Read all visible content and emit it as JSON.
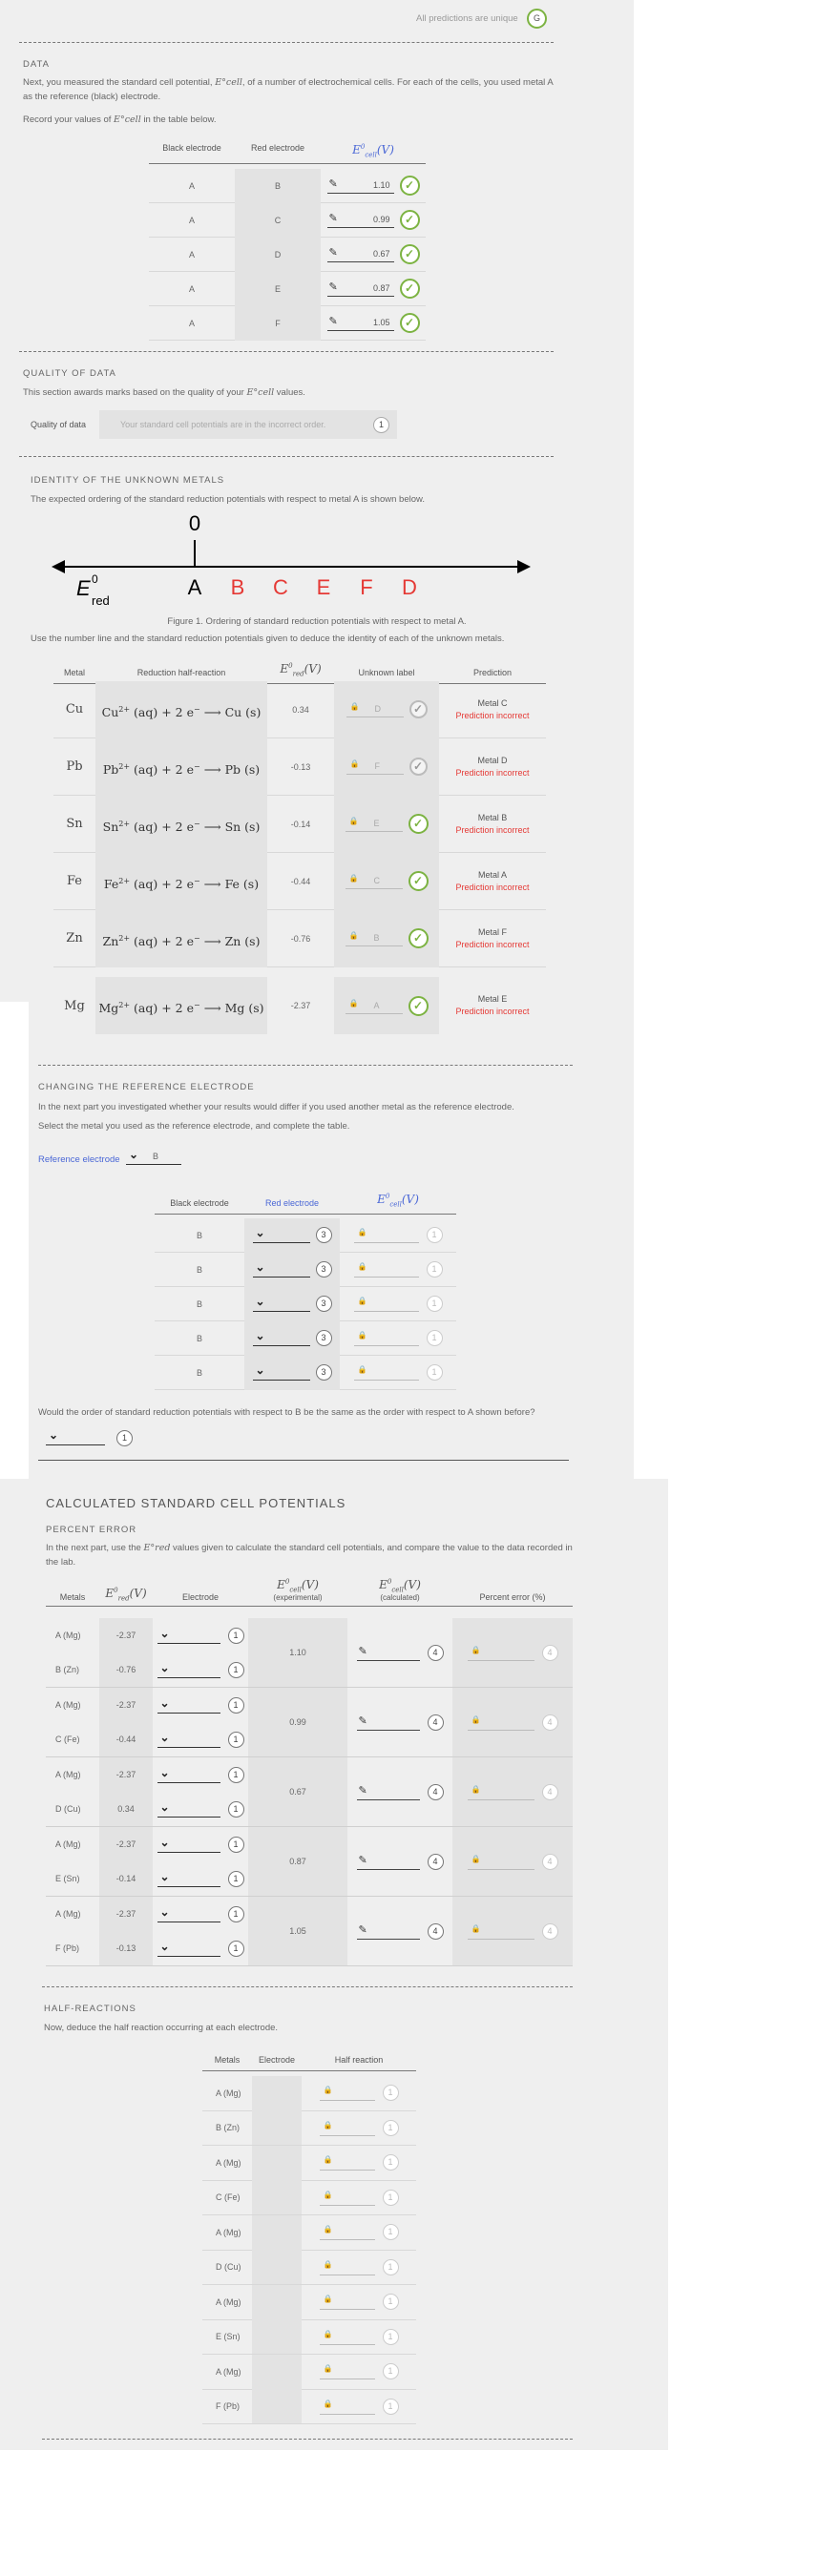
{
  "unique_note": "All predictions are unique",
  "unique_badge": "G",
  "data_section": {
    "heading": "DATA",
    "intro_a": "Next, you measured the standard cell potential, ",
    "intro_sym": "E°cell",
    "intro_b": ", of a number of electrochemical cells. For each of the cells, you used metal A as the reference (black) electrode.",
    "record_a": "Record your values of ",
    "record_b": " in the table below.",
    "col_black": "Black electrode",
    "col_red": "Red electrode",
    "col_e": "E°cell(V)",
    "rows": [
      {
        "black": "A",
        "red": "B",
        "value": "1.10"
      },
      {
        "black": "A",
        "red": "C",
        "value": "0.99"
      },
      {
        "black": "A",
        "red": "D",
        "value": "0.67"
      },
      {
        "black": "A",
        "red": "E",
        "value": "0.87"
      },
      {
        "black": "A",
        "red": "F",
        "value": "1.05"
      }
    ]
  },
  "quality": {
    "heading": "QUALITY OF DATA",
    "text_a": "This section awards marks based on the quality of your ",
    "text_b": " values.",
    "label": "Quality of data",
    "message": "Your standard cell potentials are in the incorrect order.",
    "badge": "1"
  },
  "identity": {
    "heading": "IDENTITY OF THE UNKNOWN METALS",
    "intro": "The expected ordering of the standard reduction potentials with respect to metal A is shown below.",
    "zero": "0",
    "ered": "E",
    "ered_sup": "0",
    "ered_sub": "red",
    "letters": [
      {
        "t": "A",
        "c": "#000"
      },
      {
        "t": "B",
        "c": "#e53935"
      },
      {
        "t": "C",
        "c": "#e53935"
      },
      {
        "t": "E",
        "c": "#e53935"
      },
      {
        "t": "F",
        "c": "#e53935"
      },
      {
        "t": "D",
        "c": "#e53935"
      }
    ],
    "caption": "Figure 1. Ordering of standard reduction potentials with respect to metal A.",
    "instr": "Use the number line and the standard reduction potentials given to deduce the identity of each of the unknown metals.",
    "col_metal": "Metal",
    "col_half": "Reduction half-reaction",
    "col_e": "E°red(V)",
    "col_label": "Unknown label",
    "col_pred": "Prediction",
    "rows": [
      {
        "metal": "Cu",
        "ion": "Cu",
        "charge": "2+",
        "e": "0.34",
        "label": "D",
        "ok": "grey",
        "pred": "Metal C",
        "status": "Prediction incorrect"
      },
      {
        "metal": "Pb",
        "ion": "Pb",
        "charge": "2+",
        "e": "-0.13",
        "label": "F",
        "ok": "grey",
        "pred": "Metal D",
        "status": "Prediction incorrect"
      },
      {
        "metal": "Sn",
        "ion": "Sn",
        "charge": "2+",
        "e": "-0.14",
        "label": "E",
        "ok": "green",
        "pred": "Metal B",
        "status": "Prediction incorrect"
      },
      {
        "metal": "Fe",
        "ion": "Fe",
        "charge": "2+",
        "e": "-0.44",
        "label": "C",
        "ok": "green",
        "pred": "Metal A",
        "status": "Prediction incorrect"
      },
      {
        "metal": "Zn",
        "ion": "Zn",
        "charge": "2+",
        "e": "-0.76",
        "label": "B",
        "ok": "green",
        "pred": "Metal F",
        "status": "Prediction incorrect"
      },
      {
        "metal": "Mg",
        "ion": "Mg",
        "charge": "2+",
        "e": "-2.37",
        "label": "A",
        "ok": "green",
        "pred": "Metal E",
        "status": "Prediction incorrect"
      }
    ]
  },
  "reference": {
    "heading": "CHANGING THE REFERENCE ELECTRODE",
    "p1": "In the next part you investigated whether your results would differ if you used another metal as the reference electrode.",
    "p2": "Select the metal you used as the reference electrode, and complete the table.",
    "label": "Reference electrode",
    "value": "B",
    "col_black": "Black electrode",
    "col_red": "Red electrode",
    "col_e": "E°cell(V)",
    "rows": [
      {
        "black": "B",
        "badge": "3",
        "lockbadge": "1"
      },
      {
        "black": "B",
        "badge": "3",
        "lockbadge": "1"
      },
      {
        "black": "B",
        "badge": "3",
        "lockbadge": "1"
      },
      {
        "black": "B",
        "badge": "3",
        "lockbadge": "1"
      },
      {
        "black": "B",
        "badge": "3",
        "lockbadge": "1"
      }
    ],
    "question": "Would the order of standard reduction potentials with respect to B be the same as the order with respect to A shown before?",
    "qbadge": "1"
  },
  "calc": {
    "title": "CALCULATED STANDARD CELL POTENTIALS",
    "sub": "PERCENT ERROR",
    "intro_a": "In the next part, use the ",
    "intro_b": " values given to calculate the standard cell potentials, and compare the value to the data recorded in the lab.",
    "col_metals": "Metals",
    "col_ered": "E°red(V)",
    "col_electrode": "Electrode",
    "col_exp": "E°cell(V)",
    "col_exp_sub": "(experimental)",
    "col_calc": "E°cell(V)",
    "col_calc_sub": "(calculated)",
    "col_pct": "Percent error (%)",
    "groups": [
      {
        "m1": "A (Mg)",
        "e1": "-2.37",
        "m2": "B (Zn)",
        "e2": "-0.76",
        "exp": "1.10",
        "b1": "1",
        "b2": "1",
        "cb": "4",
        "pb": "4"
      },
      {
        "m1": "A (Mg)",
        "e1": "-2.37",
        "m2": "C (Fe)",
        "e2": "-0.44",
        "exp": "0.99",
        "b1": "1",
        "b2": "1",
        "cb": "4",
        "pb": "4"
      },
      {
        "m1": "A (Mg)",
        "e1": "-2.37",
        "m2": "D (Cu)",
        "e2": "0.34",
        "exp": "0.67",
        "b1": "1",
        "b2": "1",
        "cb": "4",
        "pb": "4"
      },
      {
        "m1": "A (Mg)",
        "e1": "-2.37",
        "m2": "E (Sn)",
        "e2": "-0.14",
        "exp": "0.87",
        "b1": "1",
        "b2": "1",
        "cb": "4",
        "pb": "4"
      },
      {
        "m1": "A (Mg)",
        "e1": "-2.37",
        "m2": "F (Pb)",
        "e2": "-0.13",
        "exp": "1.05",
        "b1": "1",
        "b2": "1",
        "cb": "4",
        "pb": "4"
      }
    ]
  },
  "half": {
    "heading": "HALF-REACTIONS",
    "intro": "Now, deduce the half reaction occurring at each electrode.",
    "col_metals": "Metals",
    "col_electrode": "Electrode",
    "col_half": "Half reaction",
    "rows": [
      {
        "m": "A (Mg)",
        "b": "1"
      },
      {
        "m": "B (Zn)",
        "b": "1"
      },
      {
        "m": "A (Mg)",
        "b": "1"
      },
      {
        "m": "C (Fe)",
        "b": "1"
      },
      {
        "m": "A (Mg)",
        "b": "1"
      },
      {
        "m": "D (Cu)",
        "b": "1"
      },
      {
        "m": "A (Mg)",
        "b": "1"
      },
      {
        "m": "E (Sn)",
        "b": "1"
      },
      {
        "m": "A (Mg)",
        "b": "1"
      },
      {
        "m": "F (Pb)",
        "b": "1"
      }
    ]
  }
}
